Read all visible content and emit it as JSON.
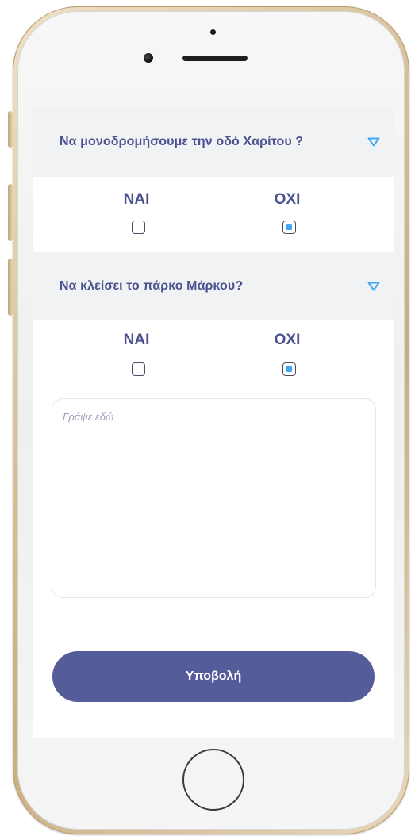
{
  "questions": [
    {
      "title": "Να μονοδρομήσουμε την οδό Χαρίτου ?",
      "options": [
        {
          "label": "ΝΑΙ",
          "checked": false
        },
        {
          "label": "ΟΧΙ",
          "checked": true
        }
      ]
    },
    {
      "title": "Να κλείσει το πάρκο Μάρκου?",
      "options": [
        {
          "label": "ΝΑΙ",
          "checked": false
        },
        {
          "label": "ΟΧΙ",
          "checked": true
        }
      ]
    }
  ],
  "comment": {
    "value": "",
    "placeholder": "Γράψε εδώ"
  },
  "submit_label": "Υποβολή",
  "icons": {
    "expand": "triangle-down-icon"
  },
  "colors": {
    "accent": "#4b5290",
    "button": "#545c99",
    "checkbox_fill": "#3fa9f5",
    "chevron": "#3fa9f5",
    "header_bg": "#f1f2f4"
  }
}
